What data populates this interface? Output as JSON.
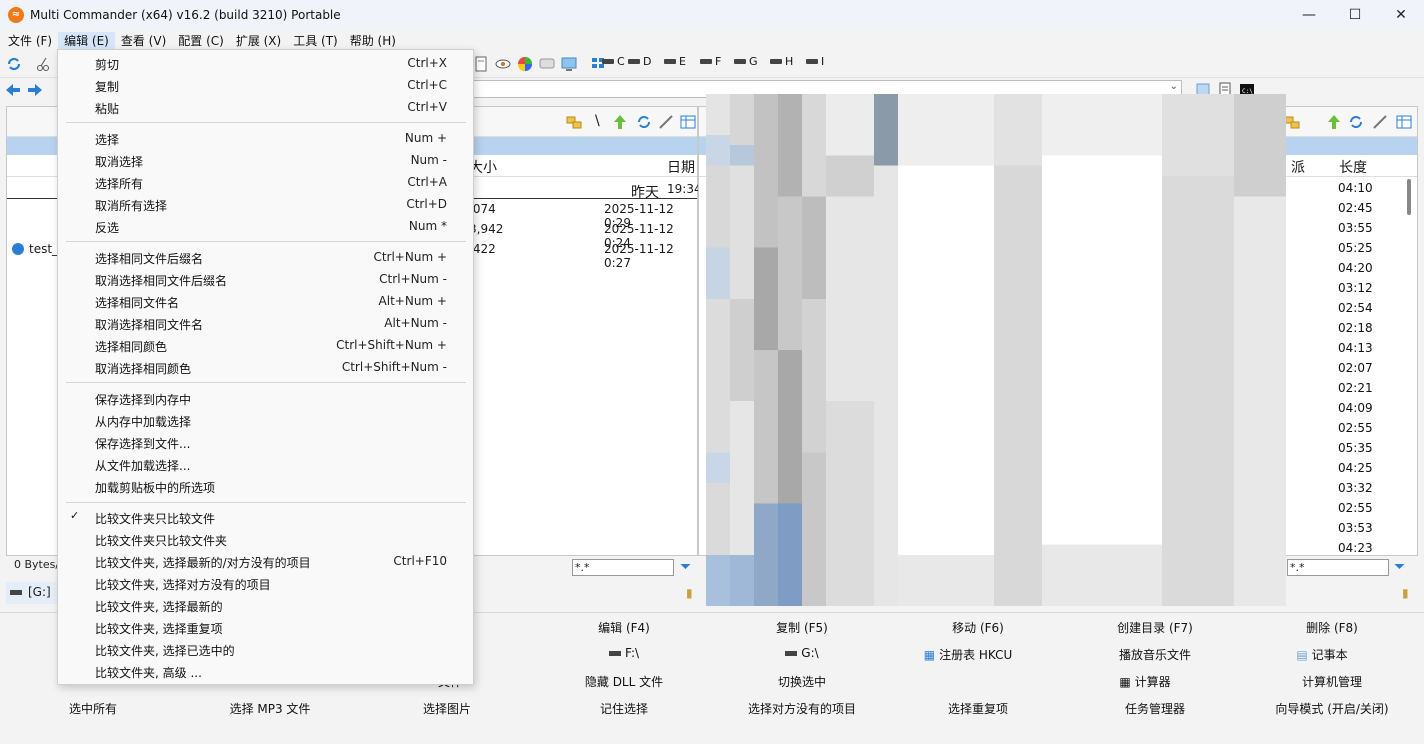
{
  "window": {
    "title": "Multi Commander (x64)  v16.2 (build 3210) Portable",
    "logo": "multi-commander-logo",
    "controls": [
      "minimize-icon",
      "maximize-icon",
      "close-icon"
    ]
  },
  "menubar": [
    "文件 (F)",
    "编辑 (E)",
    "查看 (V)",
    "配置 (C)",
    "扩展 (X)",
    "工具 (T)",
    "帮助 (H)"
  ],
  "drives": [
    "C",
    "D",
    "E",
    "F",
    "G",
    "H",
    "I"
  ],
  "left_panel": {
    "columns": {
      "size": "大小",
      "date": "日期"
    },
    "rows": [
      {
        "name": "",
        "size": "",
        "date": "昨天",
        "time": "19:34"
      },
      {
        "name": "",
        "size": ",074",
        "date": "2025-11-12 0:29"
      },
      {
        "name": "",
        "size": "3,942",
        "date": "2025-11-12 0:24"
      },
      {
        "name": "test_",
        "size": ",422",
        "date": "2025-11-12 0:27"
      }
    ],
    "status": "0 Bytes/",
    "filter": "*.*",
    "drive_label": "[G:] "
  },
  "right_panel": {
    "columns": {
      "assign": "派",
      "length": "长度"
    },
    "times": [
      "04:10",
      "02:45",
      "03:55",
      "05:25",
      "04:20",
      "03:12",
      "02:54",
      "02:18",
      "04:13",
      "02:07",
      "02:21",
      "04:09",
      "02:55",
      "05:35",
      "04:25",
      "03:32",
      "02:55",
      "03:53",
      "04:23"
    ],
    "filter": "*.*"
  },
  "button_grid": {
    "row1": [
      "编辑 (F4)",
      "复制 (F5)",
      "移动 (F6)",
      "创建目录 (F7)",
      "删除 (F8)"
    ],
    "row2": [
      "F:\\",
      "G:\\",
      "注册表 HKCU",
      "播放音乐文件",
      "记事本"
    ],
    "row3": [
      "隐藏 DLL 文件",
      "切换选中",
      "计算器",
      "计算机管理"
    ],
    "row3_partial": "文件",
    "row4": [
      "选中所有",
      "选择 MP3 文件",
      "选择图片",
      "记住选择",
      "选择对方没有的项目",
      "选择重复项",
      "任务管理器",
      "向导模式 (开启/关闭)"
    ]
  },
  "edit_menu": {
    "group1": [
      {
        "label": "剪切",
        "shortcut": "Ctrl+X"
      },
      {
        "label": "复制",
        "shortcut": "Ctrl+C"
      },
      {
        "label": "粘贴",
        "shortcut": "Ctrl+V"
      }
    ],
    "group2": [
      {
        "label": "选择",
        "shortcut": "Num +"
      },
      {
        "label": "取消选择",
        "shortcut": "Num -"
      },
      {
        "label": "选择所有",
        "shortcut": "Ctrl+A"
      },
      {
        "label": "取消所有选择",
        "shortcut": "Ctrl+D"
      },
      {
        "label": "反选",
        "shortcut": "Num *"
      }
    ],
    "group3": [
      {
        "label": "选择相同文件后缀名",
        "shortcut": "Ctrl+Num +"
      },
      {
        "label": "取消选择相同文件后缀名",
        "shortcut": "Ctrl+Num -"
      },
      {
        "label": "选择相同文件名",
        "shortcut": "Alt+Num +"
      },
      {
        "label": "取消选择相同文件名",
        "shortcut": "Alt+Num -"
      },
      {
        "label": "选择相同颜色",
        "shortcut": "Ctrl+Shift+Num +"
      },
      {
        "label": "取消选择相同颜色",
        "shortcut": "Ctrl+Shift+Num -"
      }
    ],
    "group4": [
      {
        "label": "保存选择到内存中",
        "shortcut": ""
      },
      {
        "label": "从内存中加载选择",
        "shortcut": ""
      },
      {
        "label": "保存选择到文件...",
        "shortcut": ""
      },
      {
        "label": "从文件加载选择...",
        "shortcut": ""
      },
      {
        "label": "加载剪贴板中的所选项",
        "shortcut": ""
      }
    ],
    "group5": [
      {
        "label": "比较文件夹只比较文件",
        "shortcut": "",
        "checked": true
      },
      {
        "label": "比较文件夹只比较文件夹",
        "shortcut": ""
      },
      {
        "label": "比较文件夹, 选择最新的/对方没有的项目",
        "shortcut": "Ctrl+F10"
      },
      {
        "label": "比较文件夹, 选择对方没有的项目",
        "shortcut": ""
      },
      {
        "label": "比较文件夹, 选择最新的",
        "shortcut": ""
      },
      {
        "label": "比较文件夹, 选择重复项",
        "shortcut": ""
      },
      {
        "label": "比较文件夹, 选择已选中的",
        "shortcut": ""
      },
      {
        "label": "比较文件夹, 高级 ...",
        "shortcut": ""
      }
    ],
    "checkmark": "✓"
  }
}
